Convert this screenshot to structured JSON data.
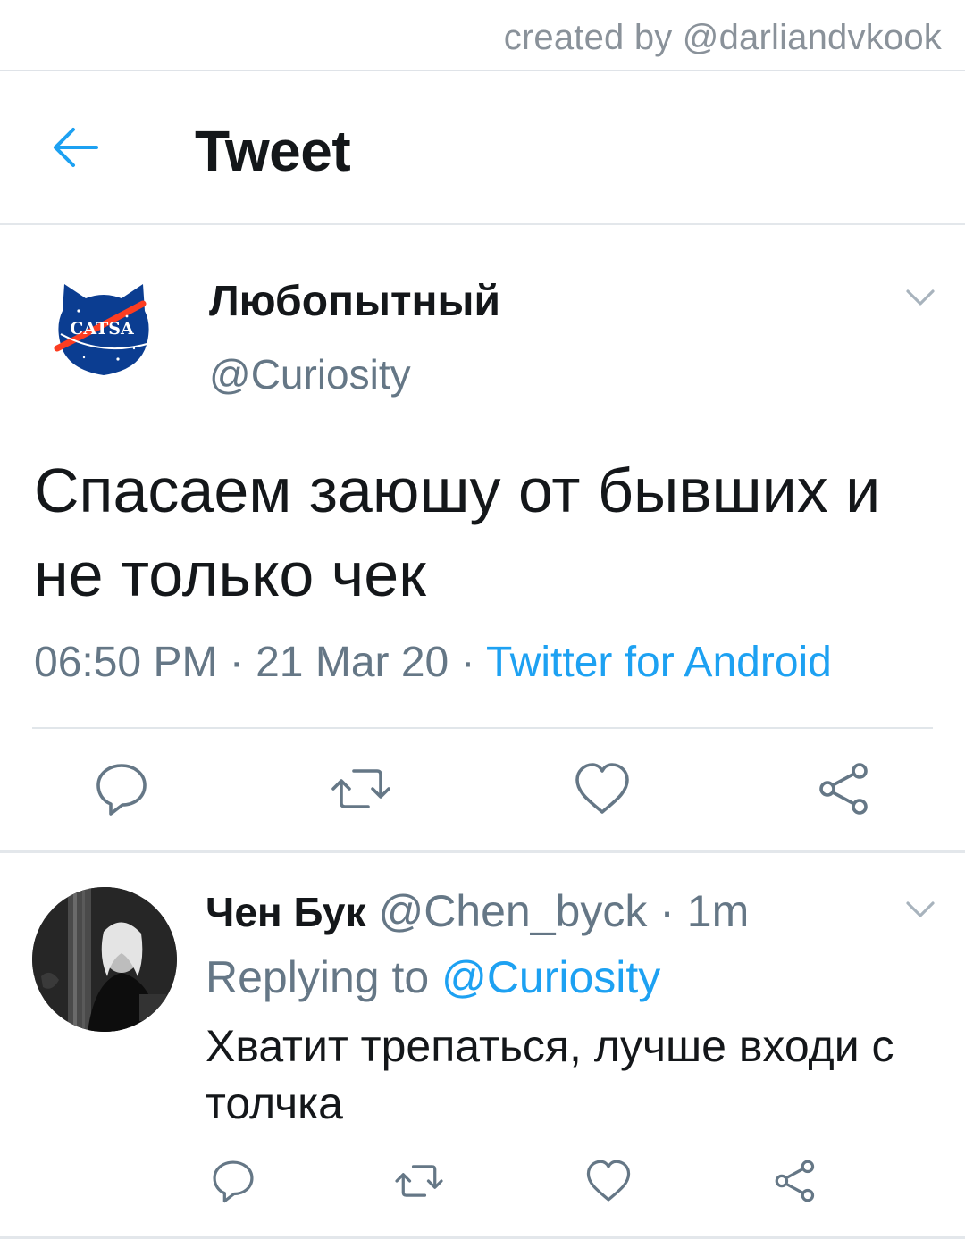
{
  "credit": "created by @darliandvkook",
  "header": {
    "title": "Tweet",
    "back_icon": "arrow-left-icon"
  },
  "main_tweet": {
    "author_name": "Любопытный",
    "author_handle": "@Curiosity",
    "avatar_logo_text": "CATSA",
    "text": "Спасаем заюшу от бывших и не только чек",
    "time": "06:50 PM",
    "date": "21 Mar 20",
    "separator": " · ",
    "source": "Twitter for Android",
    "actions": [
      "reply-icon",
      "retweet-icon",
      "like-icon",
      "share-icon"
    ]
  },
  "reply": {
    "author_name": "Чен Бук",
    "author_handle": "@Chen_byck",
    "time_ago": "1m",
    "replying_label": "Replying to",
    "replying_to": "@Curiosity",
    "text": "Хватит трепаться, лучше входи с толчка",
    "actions": [
      "reply-icon",
      "retweet-icon",
      "like-icon",
      "share-icon"
    ]
  },
  "colors": {
    "accent": "#1da1f2",
    "text": "#14171a",
    "secondary": "#657786",
    "divider": "#e1e6ea"
  }
}
